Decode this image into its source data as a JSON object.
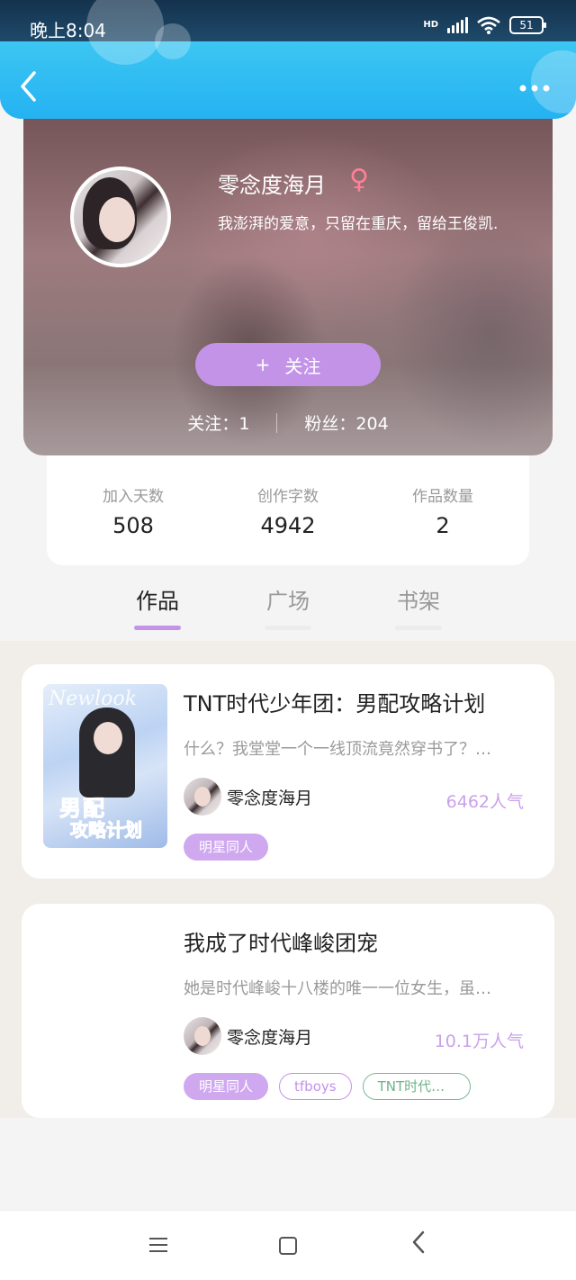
{
  "status_bar": {
    "time": "晚上8:04",
    "network": "HD",
    "battery": "51"
  },
  "nav": {
    "back_icon": "chevron-left-icon",
    "more_icon": "more-dots-icon"
  },
  "profile": {
    "username": "零念度海月",
    "gender_symbol": "♀",
    "bio": "我澎湃的爱意，只留在重庆，留给王俊凯.",
    "follow_button": "关注",
    "follow_plus": "+",
    "following_label": "关注：",
    "following_count": "1",
    "fans_label": "粉丝：",
    "fans_count": "204"
  },
  "stats": [
    {
      "label": "加入天数",
      "value": "508"
    },
    {
      "label": "创作字数",
      "value": "4942"
    },
    {
      "label": "作品数量",
      "value": "2"
    }
  ],
  "tabs": [
    "作品",
    "广场",
    "书架"
  ],
  "works": [
    {
      "title": "TNT时代少年团：男配攻略计划",
      "description": "什么？我堂堂一个一线顶流竟然穿书了？…",
      "author": "零念度海月",
      "popularity": "6462人气",
      "tags": [
        "明星同人"
      ],
      "cover_text": "Newlook",
      "cover_title": "男配",
      "cover_subtitle": "攻略计划"
    },
    {
      "title": "我成了时代峰峻团宠",
      "description": "她是时代峰峻十八楼的唯一一位女生，虽…",
      "author": "零念度海月",
      "popularity": "10.1万人气",
      "tags": [
        "明星同人",
        "tfboys",
        "TNT时代…"
      ]
    }
  ],
  "colors": {
    "accent": "#c393e8",
    "header": "#25b2f2",
    "female": "#ff7f97",
    "tag_green": "#6fb48a"
  }
}
